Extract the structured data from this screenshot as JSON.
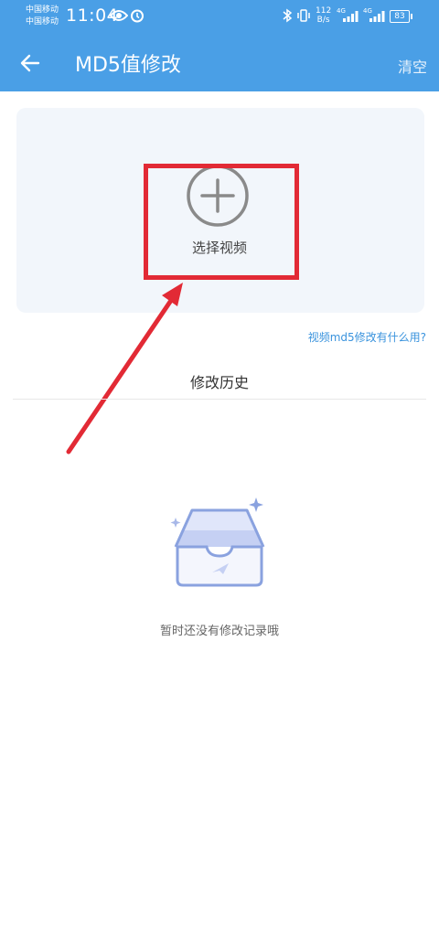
{
  "status_bar": {
    "carrier_1": "中国移动",
    "carrier_2": "中国移动",
    "time": "11:04",
    "net_speed_value": "112",
    "net_speed_unit": "B/s",
    "signal_1": "4G",
    "signal_2": "4G",
    "battery": "83"
  },
  "nav": {
    "title": "MD5值修改",
    "clear_label": "清空"
  },
  "upload": {
    "select_label": "选择视频"
  },
  "help_link": "视频md5修改有什么用?",
  "history": {
    "title": "修改历史",
    "empty_text": "暂时还没有修改记录哦"
  },
  "colors": {
    "header": "#4a9fe6",
    "annotation": "#e22a35",
    "link": "#3a93dd"
  }
}
